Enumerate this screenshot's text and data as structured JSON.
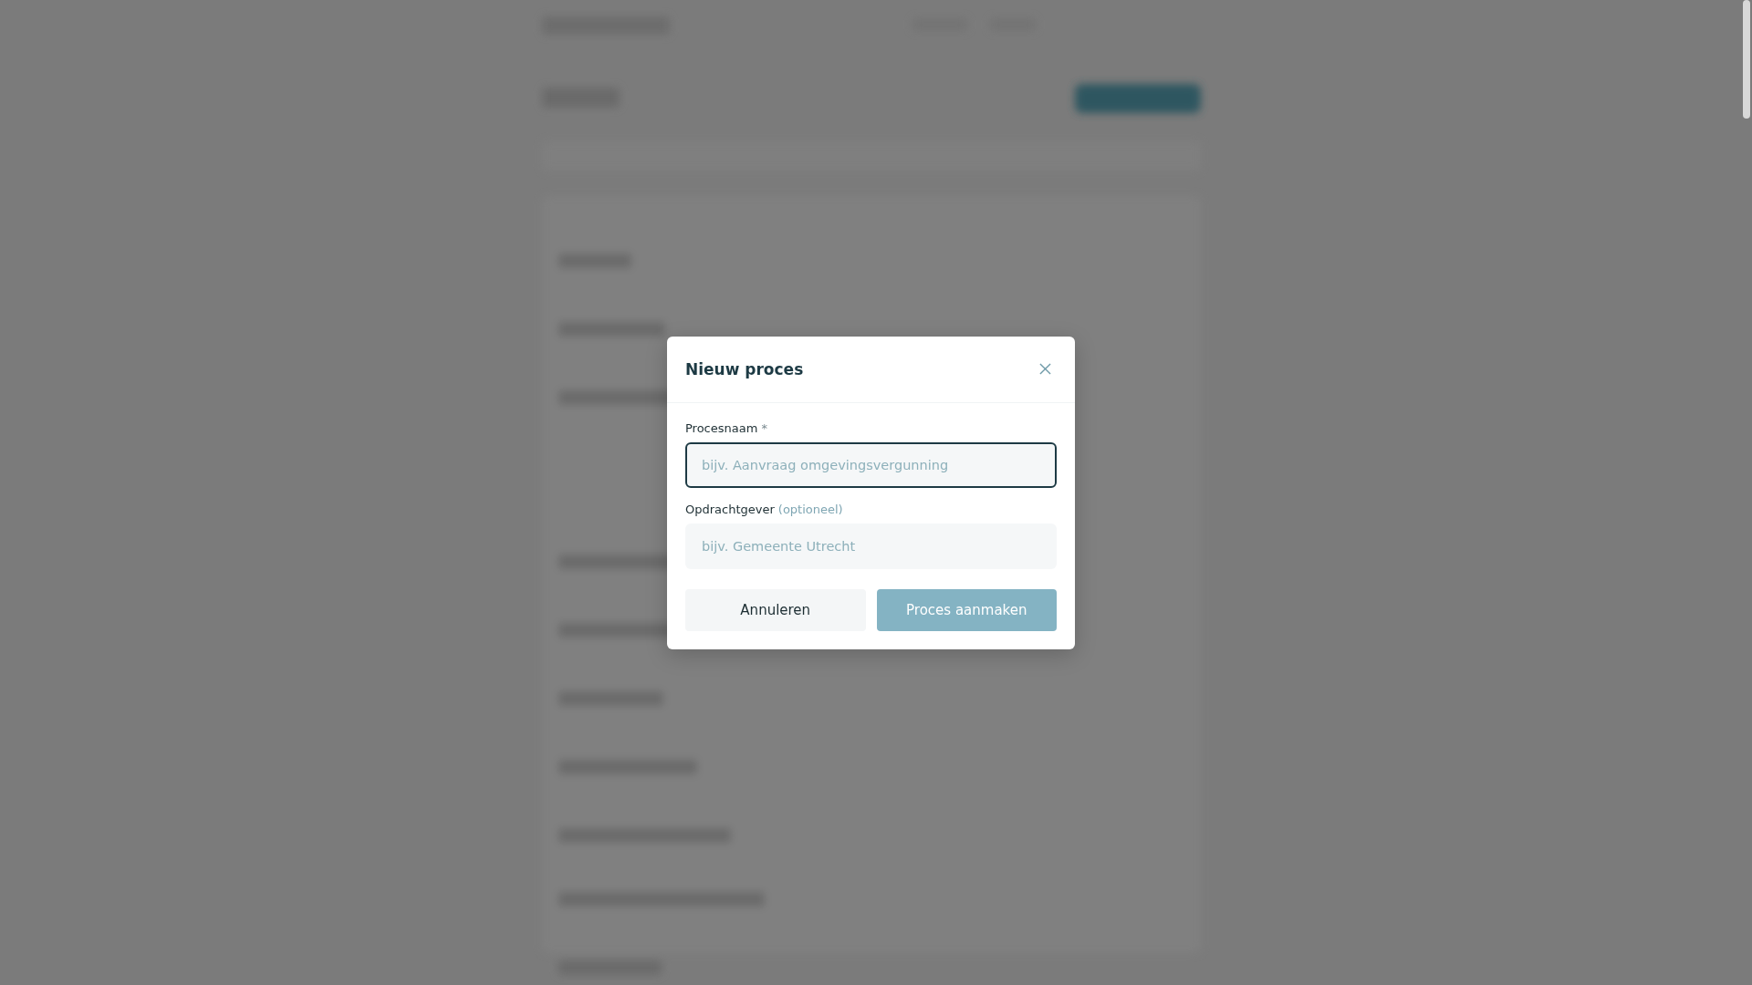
{
  "dialog": {
    "title": "Nieuw proces",
    "fields": [
      {
        "label": "Procesnaam",
        "required_mark": "*",
        "placeholder": "bijv. Aanvraag omgevingsvergunning",
        "focused": true
      },
      {
        "label": "Opdrachtgever",
        "hint": "(optioneel)",
        "placeholder": "bijv. Gemeente Utrecht",
        "focused": false
      }
    ],
    "cancel_button": "Annuleren",
    "submit_button": {
      "label": "Proces aanmaken",
      "disabled": true
    }
  }
}
